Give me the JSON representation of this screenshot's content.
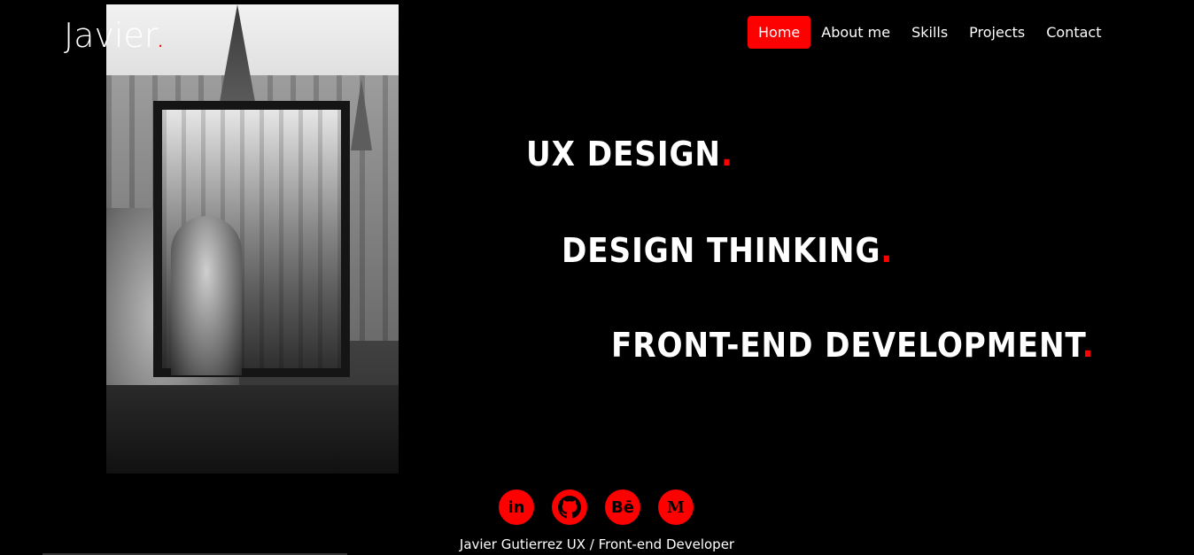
{
  "brand": {
    "name": "Javier",
    "dot": "."
  },
  "nav": {
    "items": [
      {
        "label": "Home",
        "active": true
      },
      {
        "label": "About me",
        "active": false
      },
      {
        "label": "Skills",
        "active": false
      },
      {
        "label": "Projects",
        "active": false
      },
      {
        "label": "Contact",
        "active": false
      }
    ]
  },
  "headlines": [
    {
      "text": "UX DESIGN",
      "dot": "."
    },
    {
      "text": "DESIGN THINKING",
      "dot": "."
    },
    {
      "text": "FRONT-END DEVELOPMENT",
      "dot": "."
    }
  ],
  "social": [
    {
      "name": "linkedin-icon",
      "glyph": "in"
    },
    {
      "name": "github-icon",
      "glyph": ""
    },
    {
      "name": "behance-icon",
      "glyph": "Bē"
    },
    {
      "name": "medium-icon",
      "glyph": "M"
    }
  ],
  "footer": {
    "text": "Javier Gutierrez UX / Front-end Developer"
  },
  "colors": {
    "accent": "#ff0000",
    "background": "#000000",
    "text": "#ffffff"
  }
}
